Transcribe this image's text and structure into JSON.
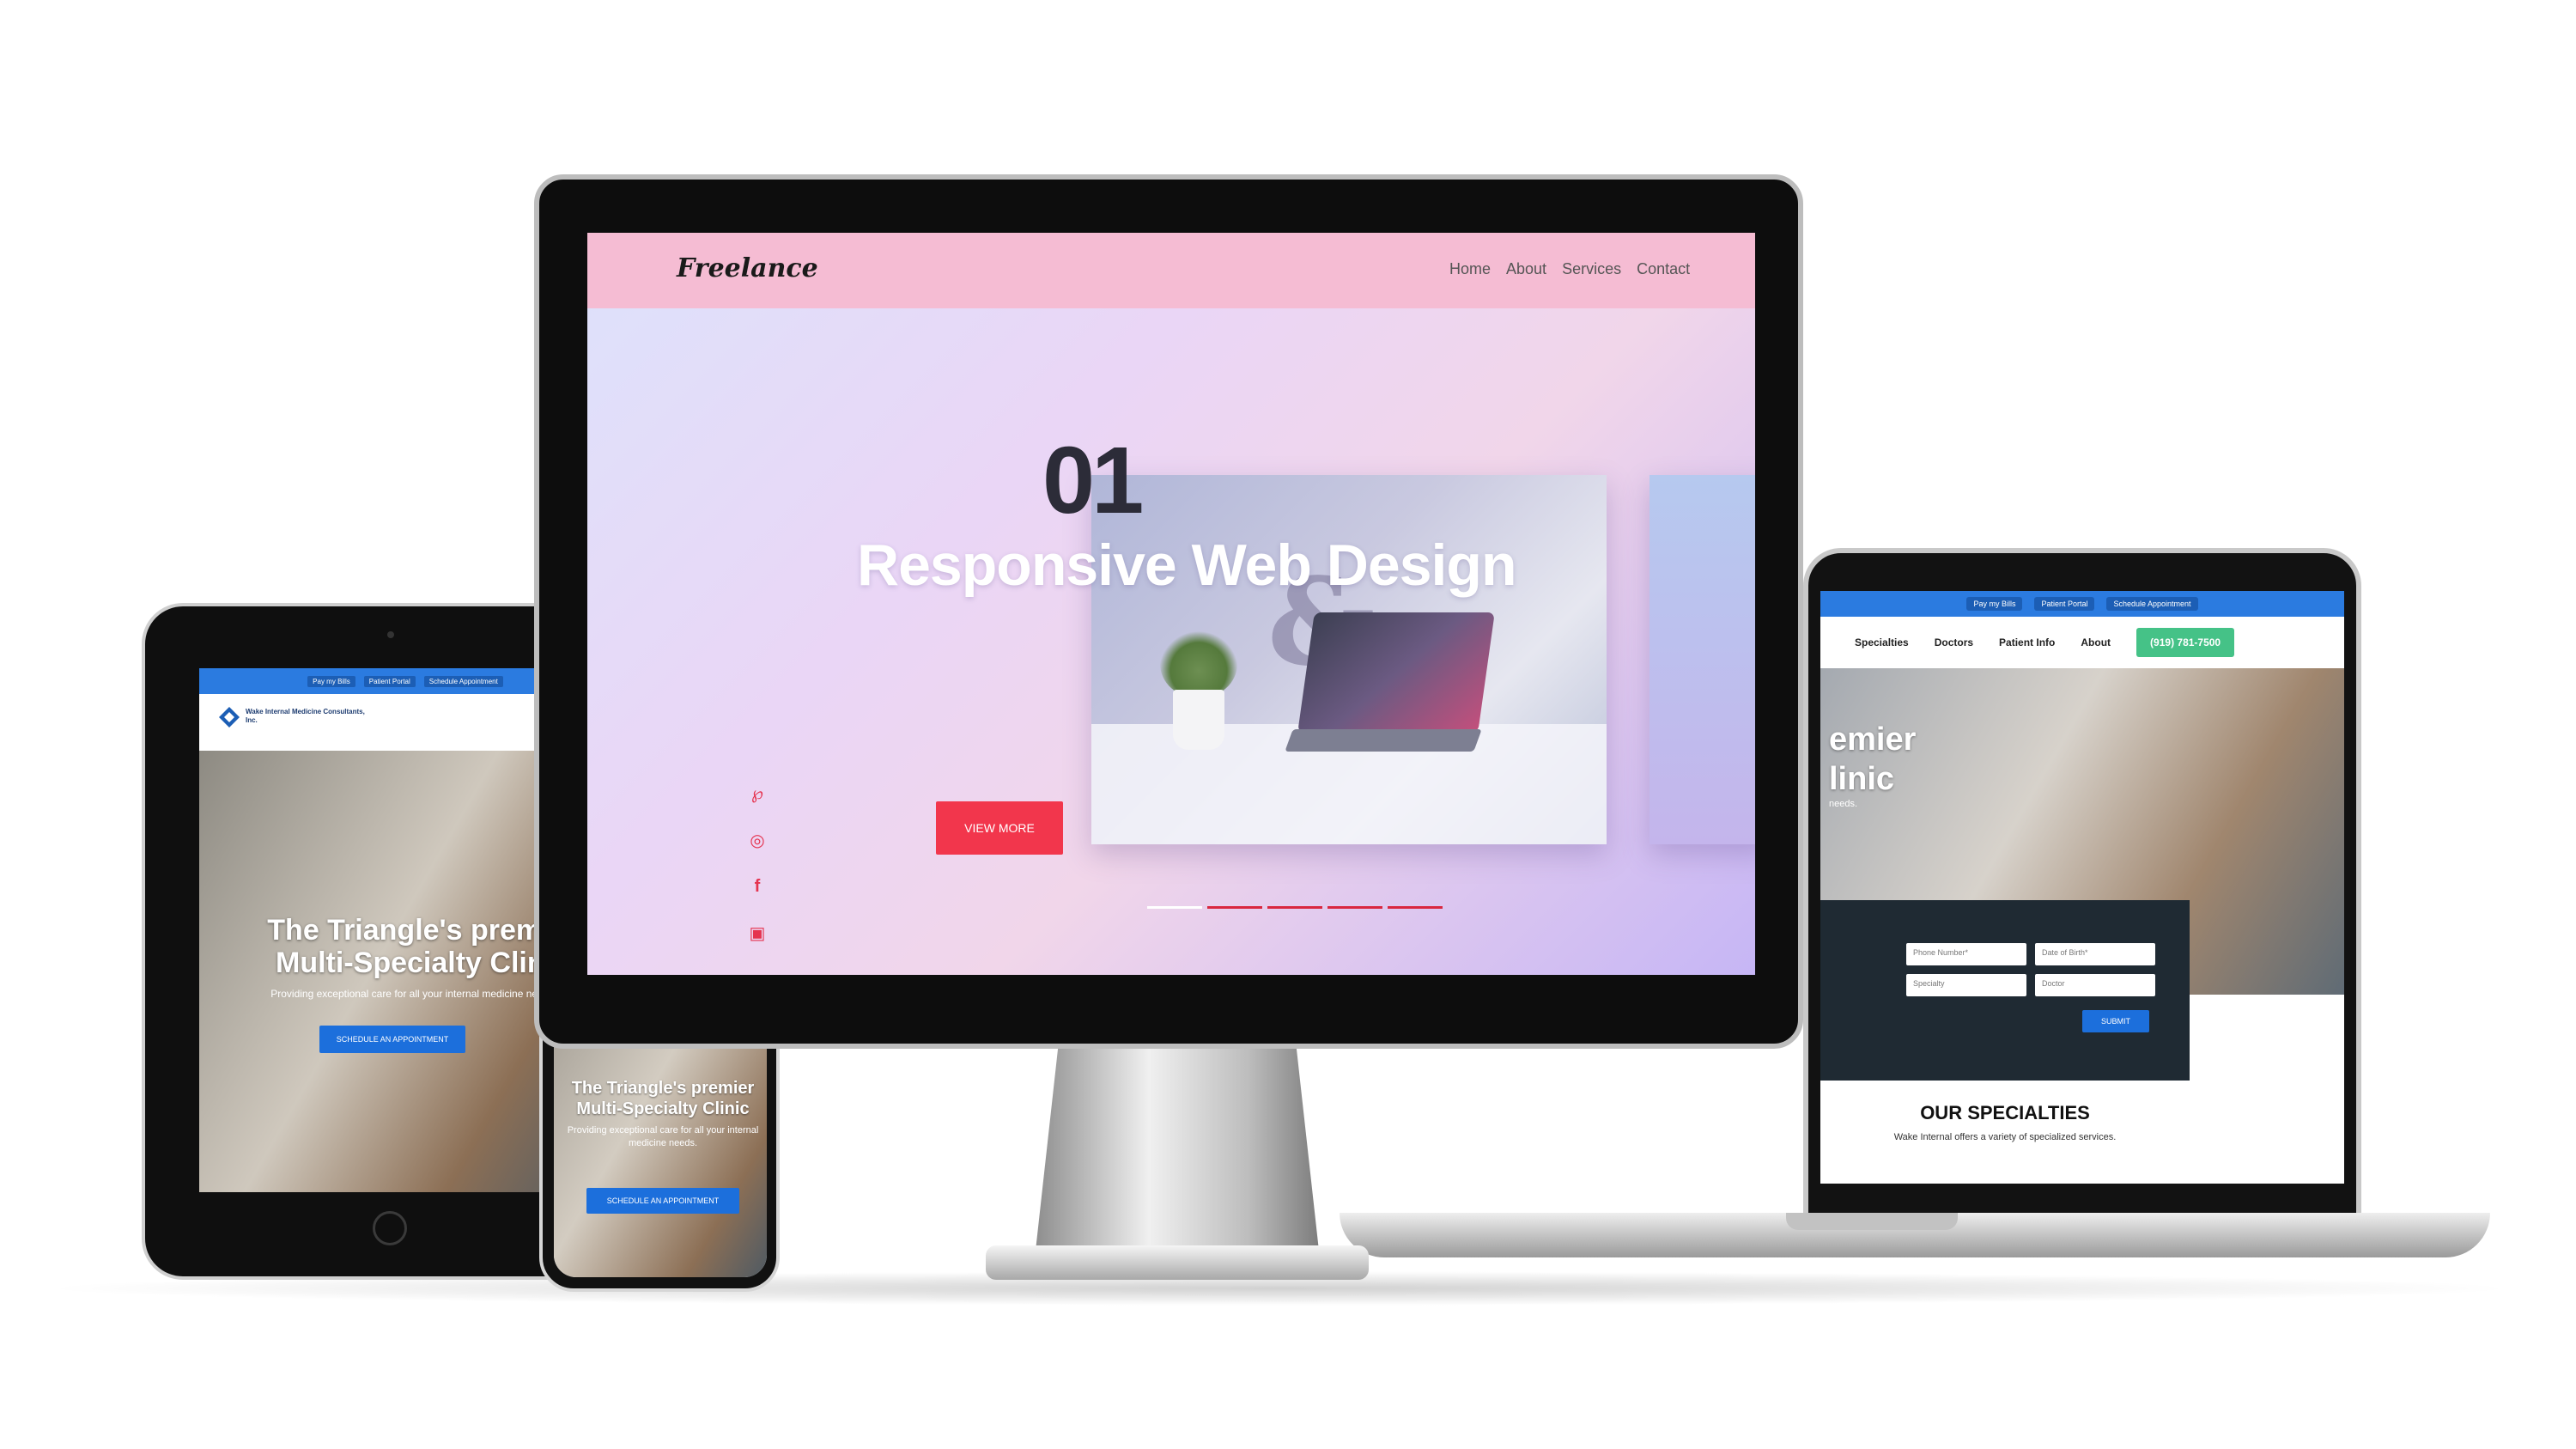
{
  "monitor": {
    "logo": "Freelance",
    "nav": [
      "Home",
      "About",
      "Services",
      "Contact"
    ],
    "slide_number": "01",
    "title": "Responsive Web Design",
    "button": "VIEW MORE",
    "social_icons": [
      "pinterest-icon",
      "dribbble-icon",
      "facebook-icon",
      "instagram-icon"
    ],
    "slider_dots": 5,
    "accent": "#f2364c",
    "nav_bg": "#f5bcd3"
  },
  "laptop": {
    "topbar": [
      "Pay my Bills",
      "Patient Portal",
      "Schedule Appointment"
    ],
    "nav": [
      "Specialties",
      "Doctors",
      "Patient Info",
      "About"
    ],
    "phone": "(919) 781-7500",
    "hero_line1": "emier",
    "hero_line2": "linic",
    "hero_sub": "needs.",
    "form_fields": [
      "Phone Number*",
      "Date of Birth*",
      "Specialty",
      "Doctor"
    ],
    "submit": "SUBMIT",
    "specialties_title": "OUR SPECIALTIES",
    "specialties_sub": "Wake Internal offers a variety of specialized services."
  },
  "tablet": {
    "topbar": [
      "Pay my Bills",
      "Patient Portal",
      "Schedule Appointment"
    ],
    "logo": "Wake Internal Medicine Consultants, Inc.",
    "hero_title": "The Triangle's premier Multi-Specialty Clinic",
    "hero_sub": "Providing exceptional care for all your internal medicine needs.",
    "button": "SCHEDULE AN APPOINTMENT"
  },
  "phone": {
    "hero_title": "The Triangle's premier Multi-Specialty Clinic",
    "hero_sub": "Providing exceptional care for all your internal medicine needs.",
    "button": "SCHEDULE AN APPOINTMENT"
  }
}
